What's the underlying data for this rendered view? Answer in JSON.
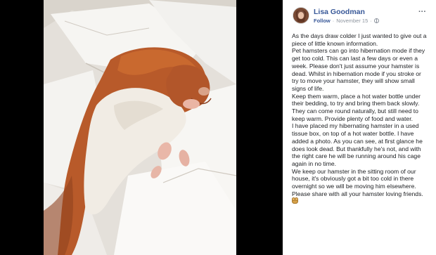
{
  "post": {
    "author": "Lisa Goodman",
    "follow_label": "Follow",
    "separator": "·",
    "date": "November 15",
    "separator2": "·",
    "more_label": "···",
    "paragraphs": [
      "As the days draw colder I just wanted to give out a piece of little known information.",
      "Pet hamsters can go into hibernation mode if they get too cold. This can last a few days or even a week. Please don't just assume your hamster is dead. Whilst in hibernation mode if you stroke or try to move your hamster, they will show small signs of life.",
      "Keep them warm, place a hot water bottle under their bedding, to try and bring them back slowly. They can come round naturally, but still need to keep warm. Provide plenty of food and water.",
      "I have placed my hibernating hamster in a used tissue box, on top of a hot water bottle. I have added a photo. As you can see, at first glance he does look dead. But thankfully he's not, and with the right care he will be running around his cage again in no time.",
      "We keep our hamster in the sitting room of our house, it's obviously got a bit too cold in there overnight so we will be moving him elsewhere.",
      "Please share with all your hamster loving friends."
    ],
    "emoji_icon": "hamster-face-icon",
    "privacy_icon": "globe-icon"
  },
  "colors": {
    "background": "#000000",
    "panel": "#ffffff",
    "name_link": "#385898",
    "meta": "#8d949e",
    "text": "#1c1e21"
  }
}
